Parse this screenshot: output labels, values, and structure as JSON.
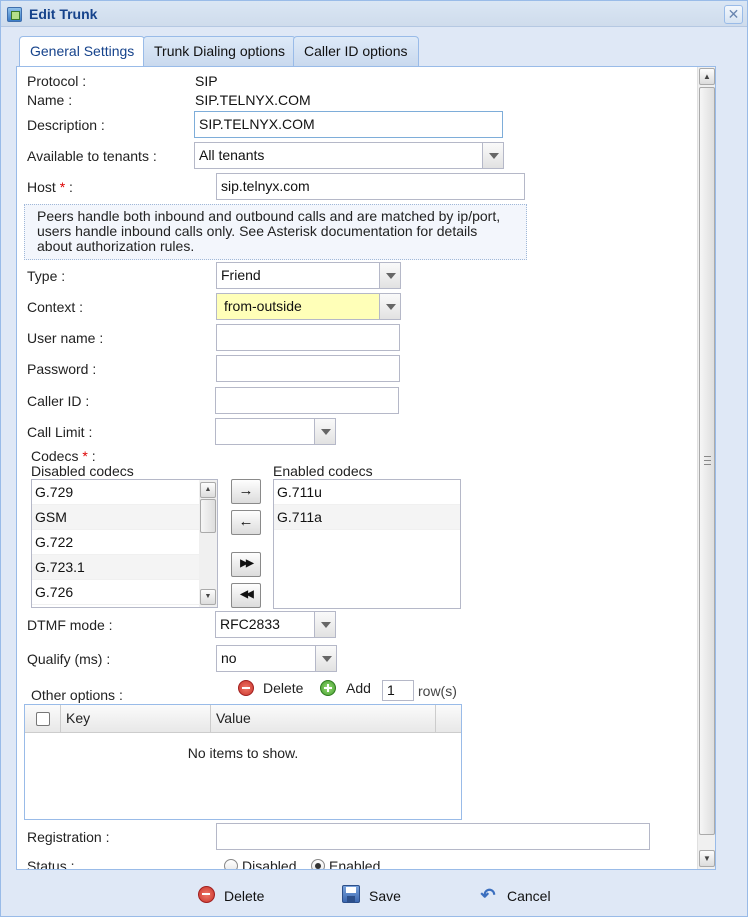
{
  "window": {
    "title": "Edit Trunk"
  },
  "tabs": [
    "General Settings",
    "Trunk Dialing options",
    "Caller ID options"
  ],
  "form": {
    "protocol_label": "Protocol :",
    "protocol_value": "SIP",
    "name_label": "Name :",
    "name_value": "SIP.TELNYX.COM",
    "description_label": "Description :",
    "description_value": "SIP.TELNYX.COM",
    "available_label": "Available to tenants :",
    "available_value": "All tenants",
    "host_label": "Host",
    "host_suffix": " :",
    "required_mark": "*",
    "host_value": "sip.telnyx.com",
    "note": "Peers handle both inbound and outbound calls and are matched by ip/port, users handle inbound calls only. See Asterisk documentation for details about authorization rules.",
    "type_label": "Type :",
    "type_value": "Friend",
    "context_label": "Context :",
    "context_value": "from-outside",
    "username_label": "User name :",
    "username_value": "",
    "password_label": "Password :",
    "password_value": "",
    "callerid_label": "Caller ID :",
    "callerid_value": "",
    "calllimit_label": "Call Limit :",
    "calllimit_value": "",
    "codecs_label": "Codecs",
    "codecs_suffix": " :",
    "disabled_codecs_label": "Disabled codecs",
    "enabled_codecs_label": "Enabled codecs",
    "disabled_codecs": [
      "G.729",
      "GSM",
      "G.722",
      "G.723.1",
      "G.726"
    ],
    "enabled_codecs": [
      "G.711u",
      "G.711a"
    ],
    "move_right": "→",
    "move_left": "←",
    "move_all_right": "▶▶",
    "move_all_left": "◀◀",
    "dtmf_label": "DTMF mode :",
    "dtmf_value": "RFC2833",
    "qualify_label": "Qualify (ms) :",
    "qualify_value": "no",
    "other_options_label": "Other options :",
    "delete_label": "Delete",
    "add_label": "Add",
    "add_rows_value": "1",
    "rows_label": "row(s)",
    "grid_key_header": "Key",
    "grid_value_header": "Value",
    "grid_empty": "No items to show.",
    "registration_label": "Registration :",
    "registration_value": "",
    "status_label": "Status :",
    "status_disabled": "Disabled",
    "status_enabled": "Enabled",
    "status_selected": "Enabled"
  },
  "footer": {
    "delete": "Delete",
    "save": "Save",
    "cancel": "Cancel"
  }
}
